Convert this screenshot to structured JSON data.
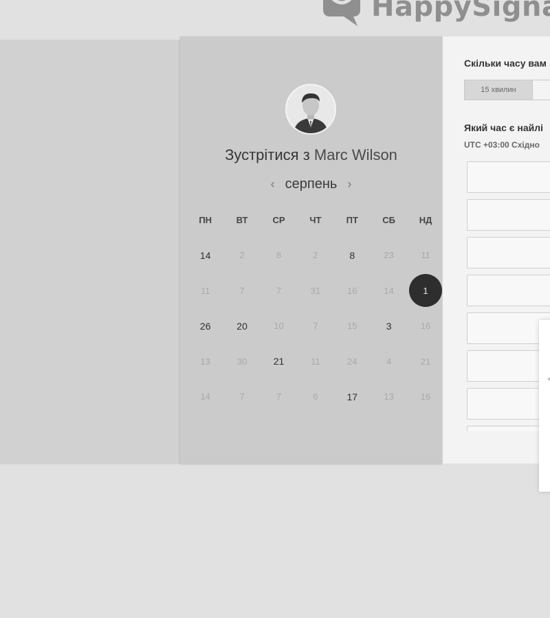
{
  "brand": {
    "name": "HappySignal"
  },
  "meeting": {
    "title_prefix": "Зустрітися з",
    "host_name": "Marc Wilson"
  },
  "calendar": {
    "month": "серпень",
    "prev_icon": "chevron-left-icon",
    "next_icon": "chevron-right-icon",
    "weekdays": [
      "ПН",
      "ВТ",
      "СР",
      "ЧТ",
      "ПТ",
      "СБ",
      "НД"
    ],
    "weeks": [
      [
        {
          "d": "14",
          "active": true
        },
        {
          "d": "2",
          "active": false
        },
        {
          "d": "8",
          "active": false
        },
        {
          "d": "2",
          "active": false
        },
        {
          "d": "8",
          "active": true
        },
        {
          "d": "23",
          "active": false
        },
        {
          "d": "11",
          "active": false
        }
      ],
      [
        {
          "d": "11",
          "active": false
        },
        {
          "d": "7",
          "active": false
        },
        {
          "d": "7",
          "active": false
        },
        {
          "d": "31",
          "active": false
        },
        {
          "d": "16",
          "active": false
        },
        {
          "d": "14",
          "active": false
        },
        {
          "d": "1",
          "active": true,
          "selected": true
        }
      ],
      [
        {
          "d": "26",
          "active": true
        },
        {
          "d": "20",
          "active": true
        },
        {
          "d": "10",
          "active": false
        },
        {
          "d": "7",
          "active": false
        },
        {
          "d": "15",
          "active": false
        },
        {
          "d": "3",
          "active": true
        },
        {
          "d": "16",
          "active": false
        }
      ],
      [
        {
          "d": "13",
          "active": false
        },
        {
          "d": "30",
          "active": false
        },
        {
          "d": "21",
          "active": true
        },
        {
          "d": "11",
          "active": false
        },
        {
          "d": "24",
          "active": false
        },
        {
          "d": "4",
          "active": false
        },
        {
          "d": "21",
          "active": false
        }
      ],
      [
        {
          "d": "14",
          "active": false
        },
        {
          "d": "7",
          "active": false
        },
        {
          "d": "7",
          "active": false
        },
        {
          "d": "6",
          "active": false
        },
        {
          "d": "17",
          "active": true
        },
        {
          "d": "13",
          "active": false
        },
        {
          "d": "16",
          "active": false
        }
      ]
    ]
  },
  "duration": {
    "question": "Скільки часу вам",
    "options": [
      "15 хвилин",
      ""
    ]
  },
  "time_select": {
    "question": "Який час є найлі",
    "timezone": "UTC +03:00 Східно",
    "slot_count": 7
  },
  "colors": {
    "background": "#e1e1e1",
    "calendar_card": "#cbcbcb",
    "selected_day": "#2e2e2e",
    "time_panel": "#f3f3f3"
  }
}
